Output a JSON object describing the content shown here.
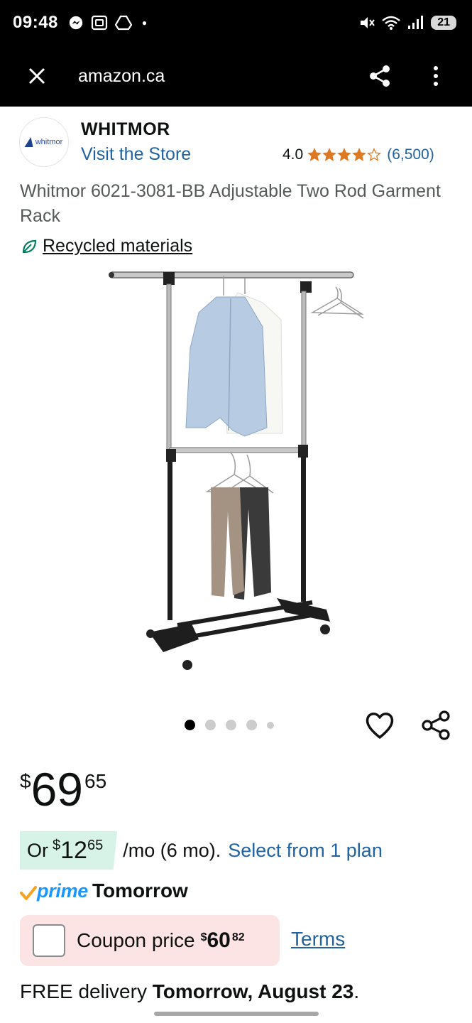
{
  "status_bar": {
    "time": "09:48",
    "battery": "21",
    "left_icons": [
      "messenger-icon",
      "screenshot-icon",
      "drive-icon"
    ],
    "right_icons": [
      "mute-icon",
      "wifi-icon",
      "signal-icon"
    ]
  },
  "browser": {
    "url": "amazon.ca",
    "close_icon": "close-icon",
    "share_icon": "share-icon",
    "menu_icon": "more-vert-icon"
  },
  "brand": {
    "logo_text": "whitmor",
    "name": "WHITMOR",
    "visit_store": "Visit the Store"
  },
  "rating": {
    "value": "4.0",
    "stars": 4,
    "out_of": 5,
    "count": "(6,500)",
    "star_color": "#de7921"
  },
  "product": {
    "title": "Whitmor 6021-3081-BB Adjustable Two Rod Garment Rack",
    "recycled_label": "Recycled materials",
    "recycled_icon": "leaf-icon"
  },
  "carousel": {
    "total": 5,
    "active": 0,
    "wishlist_icon": "heart-icon",
    "share_icon": "share-icon"
  },
  "price": {
    "symbol": "$",
    "whole": "69",
    "fraction": "65"
  },
  "installment": {
    "prefix": "Or",
    "symbol": "$",
    "whole": "12",
    "fraction": "65",
    "suffix": "/mo (6 mo).",
    "link": "Select from 1 plan",
    "chip_color": "#d7f3e8"
  },
  "prime": {
    "word": "prime",
    "day": "Tomorrow",
    "color": "#1a98ff",
    "check_color": "#f7a220"
  },
  "coupon": {
    "label": "Coupon price",
    "symbol": "$",
    "whole": "60",
    "fraction": "82",
    "terms": "Terms",
    "bg_color": "#fde4e4"
  },
  "delivery": {
    "prefix": "FREE delivery",
    "date": "Tomorrow, August 23",
    "suffix": "."
  },
  "colors": {
    "link": "#2162a1",
    "text": "#0f1111",
    "secondary_text": "#565959"
  }
}
